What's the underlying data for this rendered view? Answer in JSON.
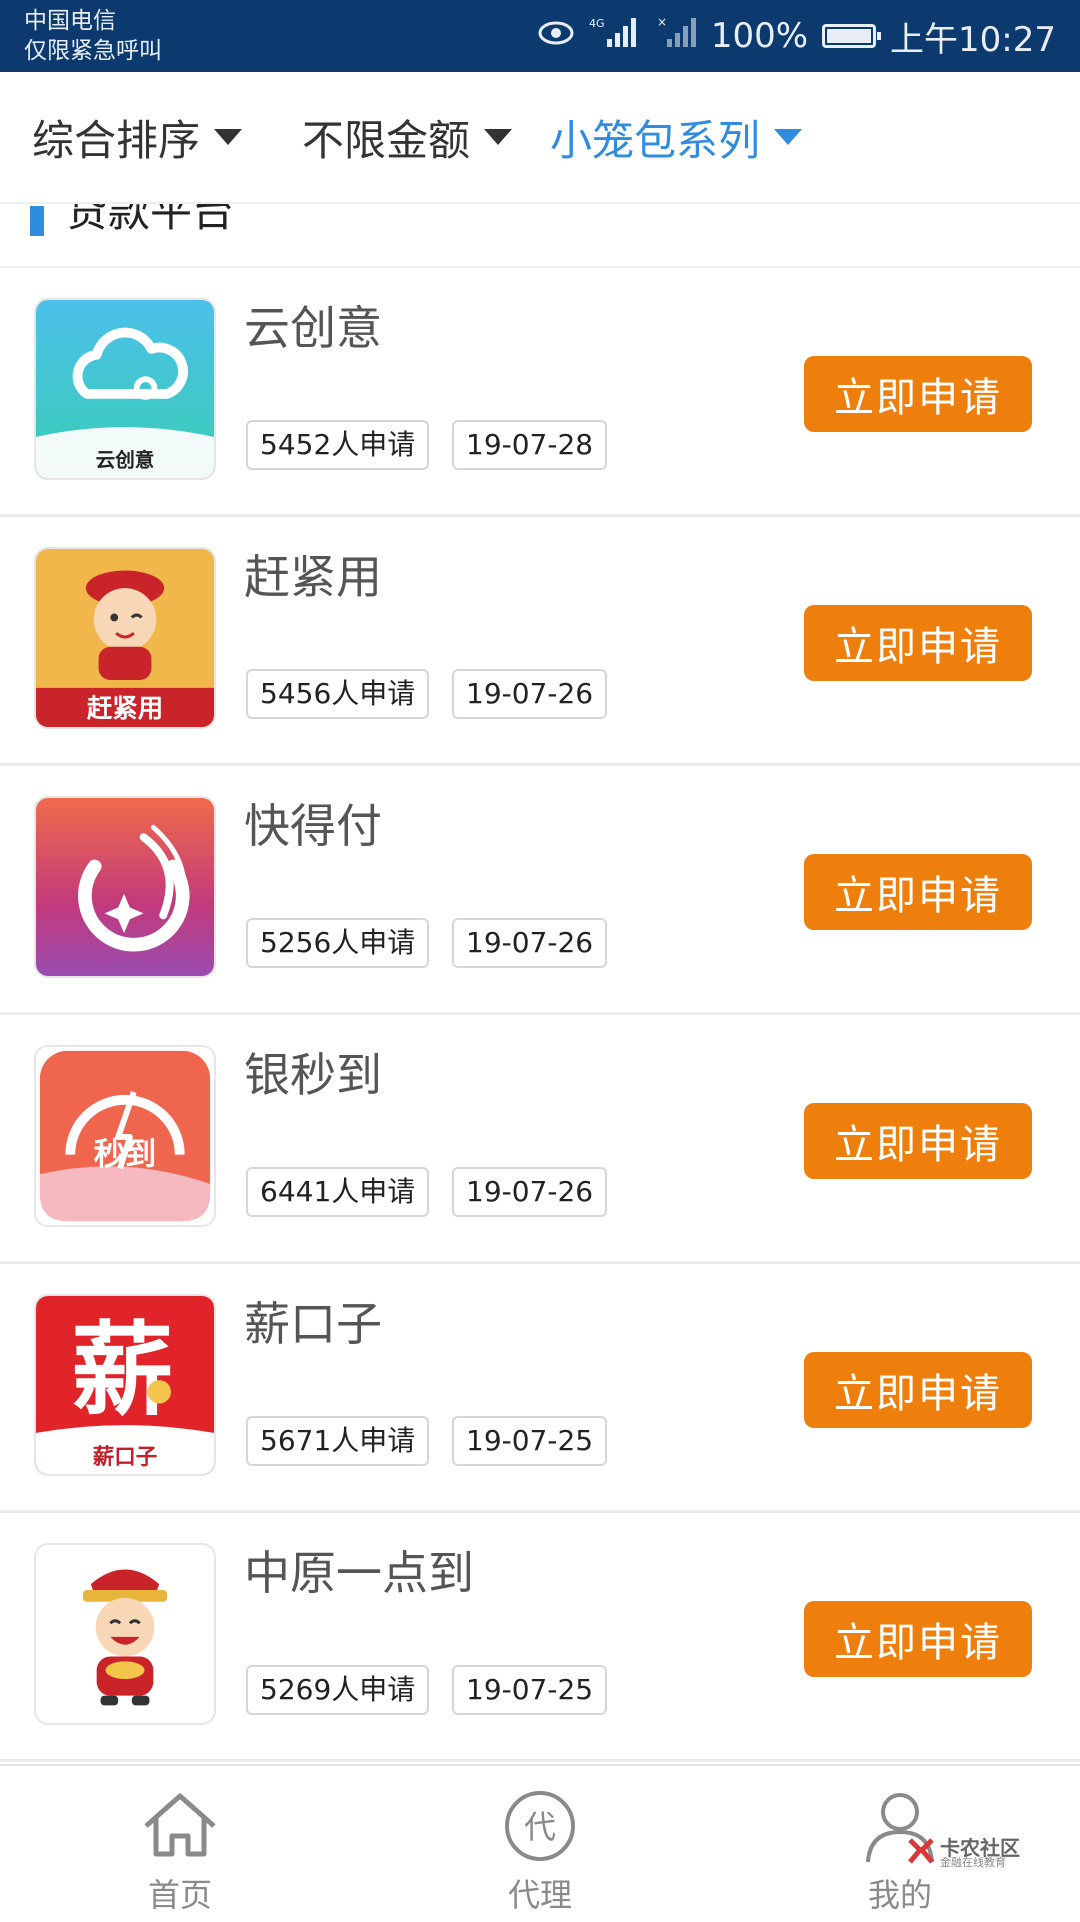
{
  "status_bar": {
    "carrier_line1": "中国电信",
    "carrier_line2": "仅限紧急呼叫",
    "signal_4g": "4G",
    "battery": "100%",
    "time": "上午10:27",
    "battery_level": 1.0
  },
  "filters": [
    {
      "label": "综合排序",
      "active": false
    },
    {
      "label": "不限金额",
      "active": false
    },
    {
      "label": "小笼包系列",
      "active": true
    }
  ],
  "section": {
    "title": "贷款平台"
  },
  "items": [
    {
      "name": "云创意",
      "applicants": "5452人申请",
      "date": "19-07-28",
      "logo_icon": "cloud-logo-icon",
      "logo_text": "云创意",
      "button": "立即申请"
    },
    {
      "name": "赶紧用",
      "applicants": "5456人申请",
      "date": "19-07-26",
      "logo_icon": "cartoon-boy-logo-icon",
      "logo_text": "赶紧用",
      "button": "立即申请"
    },
    {
      "name": "快得付",
      "applicants": "5256人申请",
      "date": "19-07-26",
      "logo_icon": "swirl-star-logo-icon",
      "button": "立即申请"
    },
    {
      "name": "银秒到",
      "applicants": "6441人申请",
      "date": "19-07-26",
      "logo_icon": "speedometer-logo-icon",
      "logo_text": "秒到",
      "button": "立即申请"
    },
    {
      "name": "薪口子",
      "applicants": "5671人申请",
      "date": "19-07-25",
      "logo_icon": "xin-character-logo-icon",
      "logo_text": "薪口子",
      "logo_char": "薪",
      "button": "立即申请"
    },
    {
      "name": "中原一点到",
      "applicants": "5269人申请",
      "date": "19-07-25",
      "logo_icon": "fortune-god-logo-icon",
      "button": "立即申请"
    }
  ],
  "bottom_nav": [
    {
      "label": "首页",
      "icon": "home-icon"
    },
    {
      "label": "代理",
      "icon": "agent-icon",
      "icon_char": "代"
    },
    {
      "label": "我的",
      "icon": "user-icon"
    }
  ],
  "watermark": {
    "title": "卡农社区",
    "subtitle": "金融在线教育"
  },
  "colors": {
    "status_bar": "#0d3a6e",
    "accent_blue": "#2f8ce0",
    "apply_orange": "#ee7f0d"
  }
}
